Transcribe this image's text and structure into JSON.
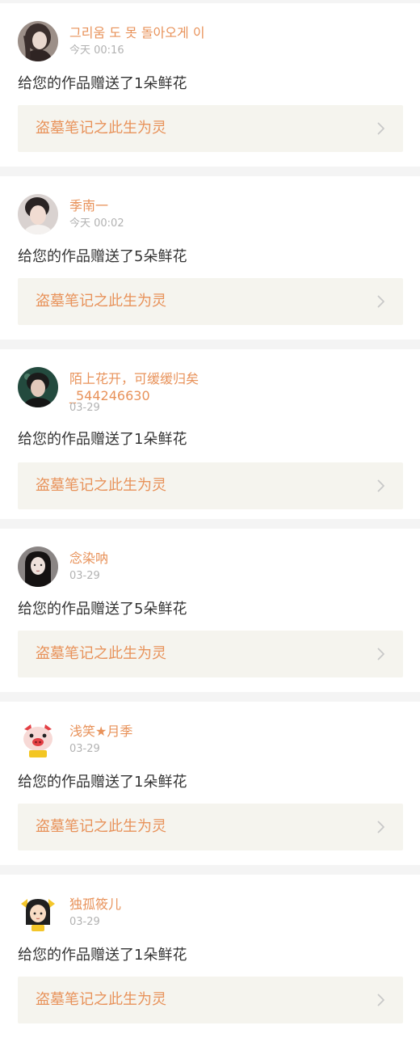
{
  "notifications": [
    {
      "user_name": "그리움 도 못 돌아오게 이",
      "time": "今天 00:16",
      "message": "给您的作品赠送了1朵鲜花",
      "work_title": "盗墓笔记之此生为灵",
      "avatar_icon": "avatar-girl-dark-hair-icon",
      "avatar_colors": {
        "bg": "#9c8f88",
        "hair": "#3b2f2d",
        "skin": "#e9d8cf"
      }
    },
    {
      "user_name": "季南一",
      "time": "今天 00:02",
      "message": "给您的作品赠送了5朵鲜花",
      "work_title": "盗墓笔记之此生为灵",
      "avatar_icon": "avatar-boy-portrait-icon",
      "avatar_colors": {
        "bg": "#d9d2d0",
        "hair": "#2a2424",
        "skin": "#f1dcd2"
      }
    },
    {
      "user_name": "陌上花开，可缓缓归矣_544246630",
      "time": "03-29",
      "message": "给您的作品赠送了1朵鲜花",
      "work_title": "盗墓笔记之此生为灵",
      "avatar_icon": "avatar-boy-dark-scene-icon",
      "avatar_colors": {
        "bg": "#234a3e",
        "hair": "#1b1b1b",
        "skin": "#e2c9bb"
      }
    },
    {
      "user_name": "念染呐",
      "time": "03-29",
      "message": "给您的作品赠送了5朵鲜花",
      "work_title": "盗墓笔记之此生为灵",
      "avatar_icon": "avatar-girl-long-hair-icon",
      "avatar_colors": {
        "bg": "#8a8584",
        "hair": "#151212",
        "skin": "#efe2dc"
      }
    },
    {
      "user_name": "浅笑★月季",
      "time": "03-29",
      "message": "给您的作品赠送了1朵鲜花",
      "work_title": "盗墓笔记之此生为灵",
      "avatar_icon": "avatar-cartoon-pig-icon",
      "avatar_colors": {
        "bg": "#ffffff",
        "face": "#f7d9d6",
        "accent": "#e33f44",
        "yellow": "#f3c623"
      }
    },
    {
      "user_name": "独孤筱儿",
      "time": "03-29",
      "message": "给您的作品赠送了1朵鲜花",
      "work_title": "盗墓笔记之此生为灵",
      "avatar_icon": "avatar-cartoon-girl-icon",
      "avatar_colors": {
        "bg": "#ffffff",
        "hair": "#1f1f1f",
        "skin": "#f8dcc4",
        "yellow": "#f4c62a"
      }
    }
  ],
  "theme": {
    "accent": "#e8925a",
    "text": "#333333",
    "muted": "#b2b2b2",
    "link_bg": "#f5f4ee",
    "page_bg": "#f4f4f4"
  },
  "chevron_icon": "chevron-right-icon"
}
